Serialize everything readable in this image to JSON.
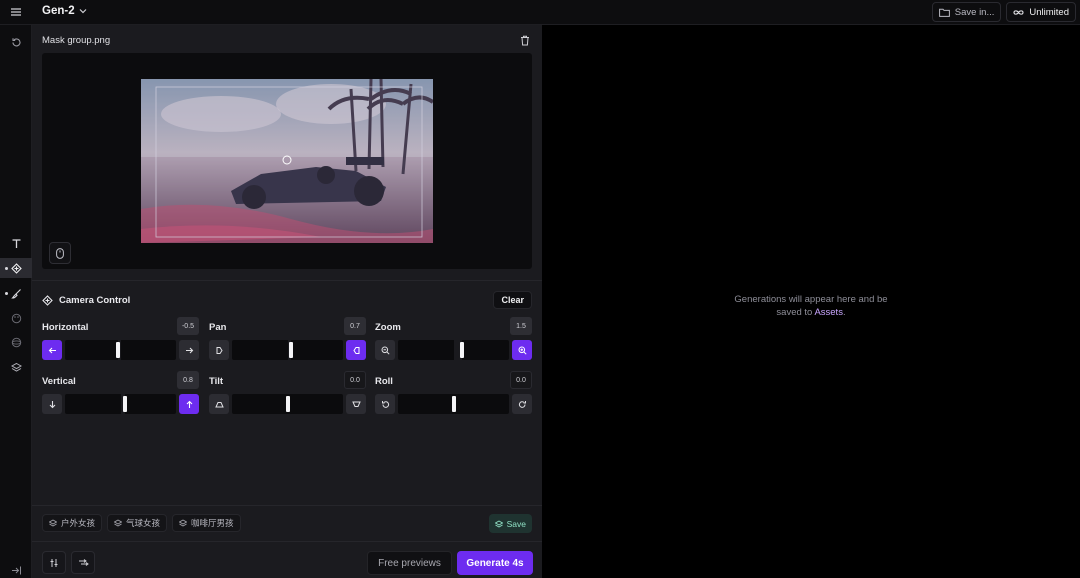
{
  "header": {
    "title": "Gen-2",
    "save_label": "Save in...",
    "plan_label": "Unlimited"
  },
  "sidebar": {
    "icons": [
      "refresh-icon",
      "text-icon",
      "camera-control-icon",
      "brush-icon",
      "palette-icon",
      "sphere-icon",
      "layers-icon",
      "collapse-icon"
    ]
  },
  "image": {
    "filename": "Mask group.png"
  },
  "camera_control": {
    "title": "Camera Control",
    "clear_label": "Clear",
    "controls": [
      {
        "label": "Horizontal",
        "value": "-0.5",
        "level": -0.5,
        "active": "left"
      },
      {
        "label": "Pan",
        "value": "0.7",
        "level": 0.7,
        "active": "right"
      },
      {
        "label": "Zoom",
        "value": "1.5",
        "level": 1.5,
        "active": "right"
      },
      {
        "label": "Vertical",
        "value": "0.8",
        "level": 0.8,
        "active": "right"
      },
      {
        "label": "Tilt",
        "value": "0.0",
        "level": 0.0,
        "active": "none"
      },
      {
        "label": "Roll",
        "value": "0.0",
        "level": 0.0,
        "active": "none"
      }
    ],
    "range": [
      -10,
      10
    ]
  },
  "presets": [
    "户外女孩",
    "气球女孩",
    "咖啡厅男孩"
  ],
  "save_preset_label": "Save",
  "footer": {
    "free_label": "Free previews",
    "generate_label": "Generate 4s"
  },
  "empty_state": {
    "line1": "Generations will appear here and be",
    "line2_prefix": "saved to ",
    "link": "Assets",
    "line2_suffix": "."
  },
  "colors": {
    "accent": "#6d2cf0",
    "save": "#8fe0c4"
  }
}
